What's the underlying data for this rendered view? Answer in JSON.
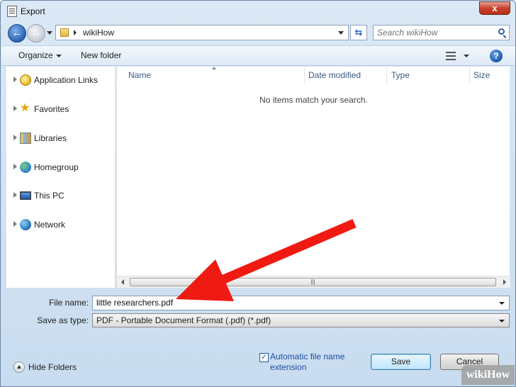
{
  "window": {
    "title": "Export",
    "close_glyph": "x"
  },
  "address_bar": {
    "path": "wikiHow"
  },
  "search": {
    "placeholder": "Search wikiHow"
  },
  "toolbar": {
    "organize_label": "Organize",
    "new_folder_label": "New folder",
    "help_glyph": "?"
  },
  "nav_pane": {
    "items": [
      {
        "label": "Application Links",
        "icon": "app-links-icon"
      },
      {
        "label": "Favorites",
        "icon": "star-icon"
      },
      {
        "label": "Libraries",
        "icon": "library-icon"
      },
      {
        "label": "Homegroup",
        "icon": "homegroup-icon"
      },
      {
        "label": "This PC",
        "icon": "computer-icon"
      },
      {
        "label": "Network",
        "icon": "network-icon"
      }
    ]
  },
  "file_list": {
    "columns": [
      "Name",
      "Date modified",
      "Type",
      "Size"
    ],
    "empty_message": "No items match your search."
  },
  "form": {
    "file_name_label": "File name:",
    "file_name_value": "little researchers.pdf",
    "save_type_label": "Save as type:",
    "save_type_value": "PDF - Portable Document Format (.pdf) (*.pdf)"
  },
  "footer": {
    "hide_folders_label": "Hide Folders",
    "auto_extension_label_line1": "Automatic file name",
    "auto_extension_label_line2": "extension",
    "auto_extension_checked": true,
    "save_label": "Save",
    "cancel_label": "Cancel"
  },
  "watermark": {
    "text": "wikiHow"
  },
  "annotation": {
    "arrow_color": "#ef1a12"
  }
}
